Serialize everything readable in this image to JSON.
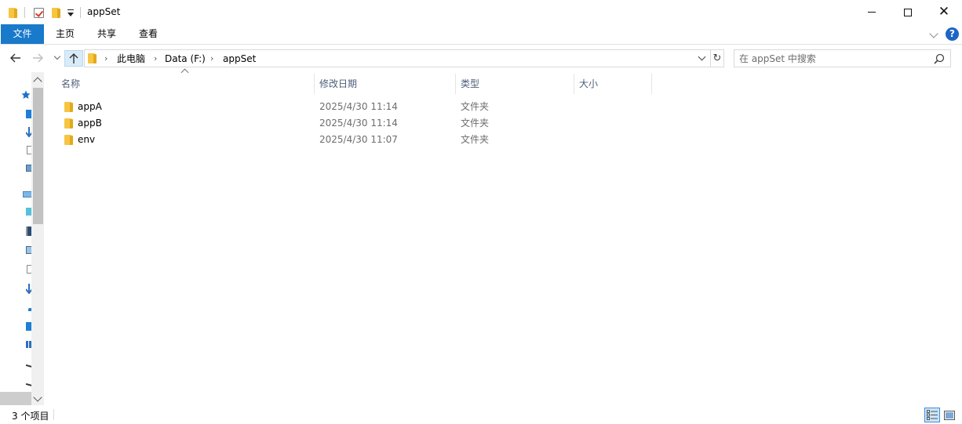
{
  "window": {
    "title": "appSet",
    "accent_color": "#1979ca"
  },
  "ribbon": {
    "tabs": [
      "文件",
      "主页",
      "共享",
      "查看"
    ],
    "help_label": "?"
  },
  "address": {
    "crumbs": [
      "此电脑",
      "Data (F:)",
      "appSet"
    ]
  },
  "search": {
    "placeholder": "在 appSet 中搜索"
  },
  "columns": [
    "名称",
    "修改日期",
    "类型",
    "大小"
  ],
  "files": [
    {
      "name": "appA",
      "modified": "2025/4/30 11:14",
      "type": "文件夹",
      "size": ""
    },
    {
      "name": "appB",
      "modified": "2025/4/30 11:14",
      "type": "文件夹",
      "size": ""
    },
    {
      "name": "env",
      "modified": "2025/4/30 11:07",
      "type": "文件夹",
      "size": ""
    }
  ],
  "status": {
    "item_count": "3 个项目"
  }
}
